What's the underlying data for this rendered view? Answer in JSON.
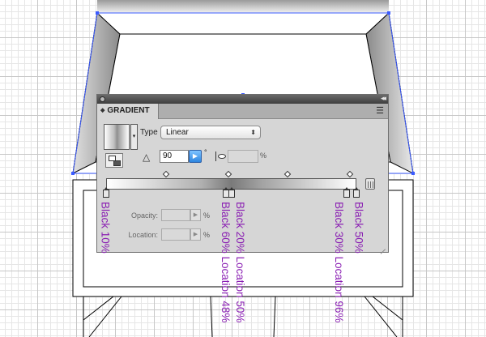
{
  "panel": {
    "title": "GRADIENT",
    "tab_arrows": "◆",
    "menu_icon": "☰",
    "collapse_icon": "◂◂",
    "type_label": "Type",
    "type_value": "Linear",
    "type_arrows": "⬍",
    "angle_value": "90",
    "angle_icon": "△",
    "angle_button_icon": "▶",
    "degree_symbol": "°",
    "aspect_percent": "%",
    "opacity_label": "Opacity:",
    "opacity_percent": "%",
    "location_label": "Location:",
    "location_percent": "%",
    "field_button_icon": "▶",
    "swatch_dropdown_icon": "▾"
  },
  "stops": [
    {
      "annotation": "Black 10%",
      "location": 0
    },
    {
      "annotation": "Black 60% Location 48%",
      "location": 48
    },
    {
      "annotation": "Black 20% Location 50%",
      "location": 50
    },
    {
      "annotation": "Black 30% Location 96%",
      "location": 96
    },
    {
      "annotation": "Black 50%",
      "location": 100
    }
  ],
  "colors": {
    "annotation": "#8a1fb3",
    "selection": "#3b5bff",
    "panel_bg": "#d6d6d6"
  }
}
